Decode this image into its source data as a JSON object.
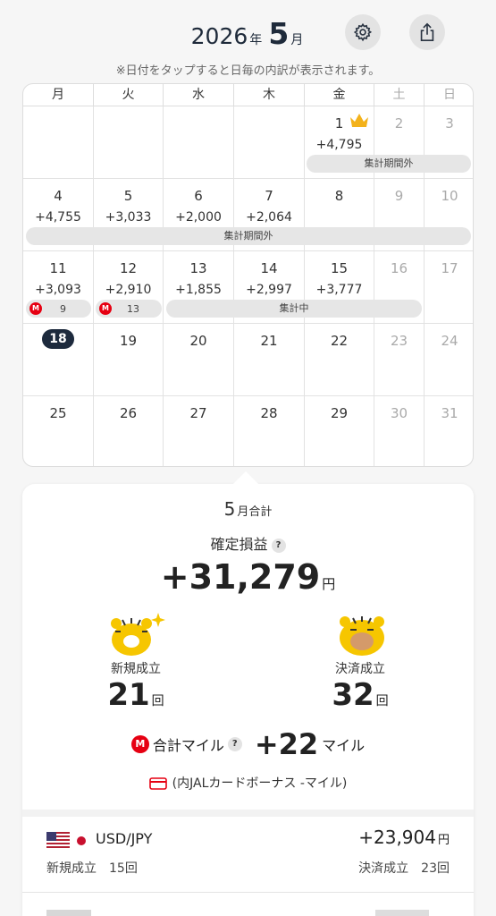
{
  "header": {
    "year": "2026",
    "year_unit": "年",
    "month": "5",
    "month_unit": "月",
    "settings_icon": "gear-icon",
    "share_icon": "share-icon",
    "note": "※日付をタップすると日毎の内訳が表示されます。"
  },
  "calendar": {
    "weekdays": [
      "月",
      "火",
      "水",
      "木",
      "金",
      "土",
      "日"
    ],
    "weeks": [
      [
        {
          "day": "",
          "amount": ""
        },
        {
          "day": "",
          "amount": ""
        },
        {
          "day": "",
          "amount": ""
        },
        {
          "day": "",
          "amount": ""
        },
        {
          "day": "1",
          "amount": "+4,795"
        },
        {
          "day": "2",
          "amount": ""
        },
        {
          "day": "3",
          "amount": ""
        }
      ],
      [
        {
          "day": "4",
          "amount": "+4,755"
        },
        {
          "day": "5",
          "amount": "+3,033"
        },
        {
          "day": "6",
          "amount": "+2,000"
        },
        {
          "day": "7",
          "amount": "+2,064"
        },
        {
          "day": "8",
          "amount": ""
        },
        {
          "day": "9",
          "amount": ""
        },
        {
          "day": "10",
          "amount": ""
        }
      ],
      [
        {
          "day": "11",
          "amount": "+3,093"
        },
        {
          "day": "12",
          "amount": "+2,910"
        },
        {
          "day": "13",
          "amount": "+1,855"
        },
        {
          "day": "14",
          "amount": "+2,997"
        },
        {
          "day": "15",
          "amount": "+3,777"
        },
        {
          "day": "16",
          "amount": ""
        },
        {
          "day": "17",
          "amount": ""
        }
      ],
      [
        {
          "day": "18",
          "amount": ""
        },
        {
          "day": "19",
          "amount": ""
        },
        {
          "day": "20",
          "amount": ""
        },
        {
          "day": "21",
          "amount": ""
        },
        {
          "day": "22",
          "amount": ""
        },
        {
          "day": "23",
          "amount": ""
        },
        {
          "day": "24",
          "amount": ""
        }
      ],
      [
        {
          "day": "25",
          "amount": ""
        },
        {
          "day": "26",
          "amount": ""
        },
        {
          "day": "27",
          "amount": ""
        },
        {
          "day": "28",
          "amount": ""
        },
        {
          "day": "29",
          "amount": ""
        },
        {
          "day": "30",
          "amount": ""
        },
        {
          "day": "31",
          "amount": ""
        }
      ]
    ],
    "today": "18",
    "crown_day": "1",
    "bands": {
      "week1": "集計期間外",
      "week2": "集計期間外",
      "week3": "集計中"
    },
    "mile_chips": [
      {
        "icon": "M",
        "value": "9"
      },
      {
        "icon": "M",
        "value": "13"
      }
    ]
  },
  "summary": {
    "month": "5",
    "month_suffix": "月合計",
    "pl_label": "確定損益",
    "help": "?",
    "pl_value": "+31,279",
    "yen": "円",
    "new_label": "新規成立",
    "new_value": "21",
    "settle_label": "決済成立",
    "settle_value": "32",
    "count_unit": "回",
    "miles_badge": "M",
    "miles_label": "合計マイル",
    "miles_value": "+22",
    "miles_unit": "マイル",
    "card_note": "(内JALカードボーナス -マイル)"
  },
  "pairs": [
    {
      "name": "USD/JPY",
      "profit": "+23,904",
      "yen": "円",
      "new_label": "新規成立",
      "new_value": "15回",
      "settle_label": "決済成立",
      "settle_value": "23回"
    }
  ],
  "colors": {
    "navy": "#1d2a3d",
    "red": "#e60012",
    "crown": "#f3b21b",
    "mascot": "#f6c600"
  }
}
